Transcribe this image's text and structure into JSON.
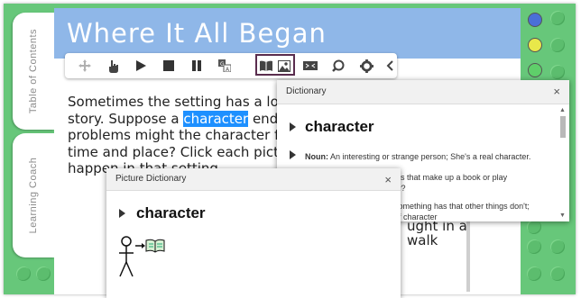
{
  "page": {
    "title": "Where It All Began",
    "body_lines": [
      "Sometimes the setting has a lot",
      "story. Suppose a ",
      "character",
      " end",
      "problems might the character f",
      "time and place? Click each pictu",
      "happen in that setting."
    ]
  },
  "side_tabs": [
    {
      "label": "Table of Contents"
    },
    {
      "label": "Learning Coach"
    }
  ],
  "toolbar": {
    "icons": [
      "move-icon",
      "hand-pointer-icon",
      "play-icon",
      "stop-icon",
      "pause-icon",
      "translate-icon",
      "book-icon",
      "picture-icon",
      "text-to-speech-icon",
      "search-icon",
      "gear-icon",
      "chevron-left-icon"
    ]
  },
  "colors": {
    "blue_dot": "#4a6fd8",
    "yellow_dot": "#e8e84a",
    "green_dot": "#5fcf6a",
    "title_bar": "#8fb7e8",
    "frame": "#67c77a",
    "highlight_box": "#5a2d4e"
  },
  "dictionary": {
    "title": "Dictionary",
    "close": "×",
    "word": "character",
    "noun_label": "Noun:",
    "noun_def": "An interesting or strange person; She's a real character.",
    "def2": "or animals that make up a book or play",
    "def2b": "character?",
    "def3": "something has that other things don't;",
    "def3b": "of character"
  },
  "picture_dictionary": {
    "title": "Picture Dictionary",
    "close": "×",
    "word": "character"
  },
  "underlying_text": {
    "line1": "ught in a",
    "line2": "walk"
  }
}
